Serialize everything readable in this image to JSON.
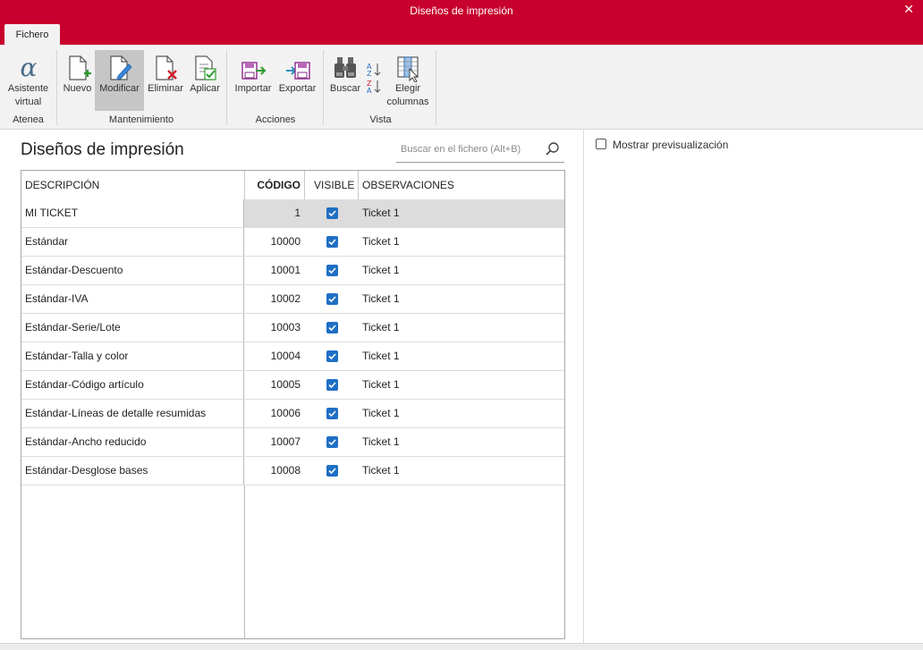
{
  "window": {
    "title": "Diseños de impresión",
    "close": "✕"
  },
  "tabs": [
    {
      "label": "Fichero"
    }
  ],
  "ribbon": {
    "groups": [
      {
        "label": "Atenea"
      },
      {
        "label": "Mantenimiento"
      },
      {
        "label": "Acciones"
      },
      {
        "label": "Vista"
      }
    ],
    "buttons": {
      "asistente": {
        "line1": "Asistente",
        "line2": "virtual",
        "icon": "alpha-icon"
      },
      "nuevo": {
        "label": "Nuevo",
        "icon": "new-document-icon"
      },
      "modificar": {
        "label": "Modificar",
        "icon": "edit-document-icon"
      },
      "eliminar": {
        "label": "Eliminar",
        "icon": "delete-document-icon"
      },
      "aplicar": {
        "label": "Aplicar",
        "icon": "apply-document-icon"
      },
      "importar": {
        "label": "Importar",
        "icon": "import-icon"
      },
      "exportar": {
        "label": "Exportar",
        "icon": "export-icon"
      },
      "buscar": {
        "label": "Buscar",
        "icon": "binoculars-icon"
      },
      "sort": {
        "icon": "sort-az-icon"
      },
      "elegir": {
        "line1": "Elegir",
        "line2": "columnas",
        "icon": "choose-columns-icon"
      }
    }
  },
  "main": {
    "title": "Diseños de impresión",
    "search": {
      "placeholder": "Buscar en el fichero (Alt+B)"
    },
    "table": {
      "columns": {
        "descripcion": "DESCRIPCIÓN",
        "codigo": "CÓDIGO",
        "visible": "VISIBLE",
        "observaciones": "OBSERVACIONES"
      },
      "rows": [
        {
          "descripcion": "MI TICKET",
          "codigo": "1",
          "visible": true,
          "observaciones": "Ticket 1"
        },
        {
          "descripcion": "Estándar",
          "codigo": "10000",
          "visible": true,
          "observaciones": "Ticket 1"
        },
        {
          "descripcion": "Estándar-Descuento",
          "codigo": "10001",
          "visible": true,
          "observaciones": "Ticket 1"
        },
        {
          "descripcion": "Estándar-IVA",
          "codigo": "10002",
          "visible": true,
          "observaciones": "Ticket 1"
        },
        {
          "descripcion": "Estándar-Serie/Lote",
          "codigo": "10003",
          "visible": true,
          "observaciones": "Ticket 1"
        },
        {
          "descripcion": "Estándar-Talla y color",
          "codigo": "10004",
          "visible": true,
          "observaciones": "Ticket 1"
        },
        {
          "descripcion": "Estándar-Código artículo",
          "codigo": "10005",
          "visible": true,
          "observaciones": "Ticket 1"
        },
        {
          "descripcion": "Estándar-Líneas de detalle resumidas",
          "codigo": "10006",
          "visible": true,
          "observaciones": "Ticket 1"
        },
        {
          "descripcion": "Estándar-Ancho reducido",
          "codigo": "10007",
          "visible": true,
          "observaciones": "Ticket 1"
        },
        {
          "descripcion": "Estándar-Desglose bases",
          "codigo": "10008",
          "visible": true,
          "observaciones": "Ticket 1"
        }
      ]
    }
  },
  "preview": {
    "label": "Mostrar previsualización",
    "checked": false
  },
  "colors": {
    "accent": "#c8002d",
    "checkbox": "#1f6fc5",
    "selected_row": "#dcdcdc"
  }
}
